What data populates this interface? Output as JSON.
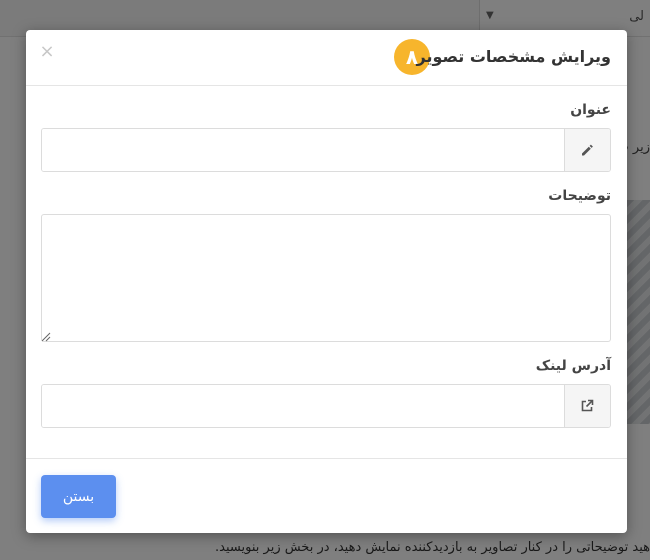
{
  "background": {
    "select_value": "لی",
    "side_text": "زیر ب",
    "bottom_text": "هید توضیحاتی را در کنار تصاویر به بازدیدکننده نمایش دهید، در بخش زیر بنویسید."
  },
  "modal": {
    "step_number": "۸",
    "title": "ویرایش مشخصات تصویر",
    "close_symbol": "×",
    "fields": {
      "title_label": "عنوان",
      "title_value": "",
      "description_label": "توضیحات",
      "description_value": "",
      "link_label": "آدرس لینک",
      "link_value": ""
    },
    "footer": {
      "close_button_label": "بستن"
    }
  },
  "icons": {
    "title_addon": "pencil-icon",
    "link_addon": "external-link-icon"
  },
  "colors": {
    "badge": "#f7b52c",
    "primary_button": "#5c8fef",
    "overlay": "rgba(0,0,0,0.5)"
  }
}
